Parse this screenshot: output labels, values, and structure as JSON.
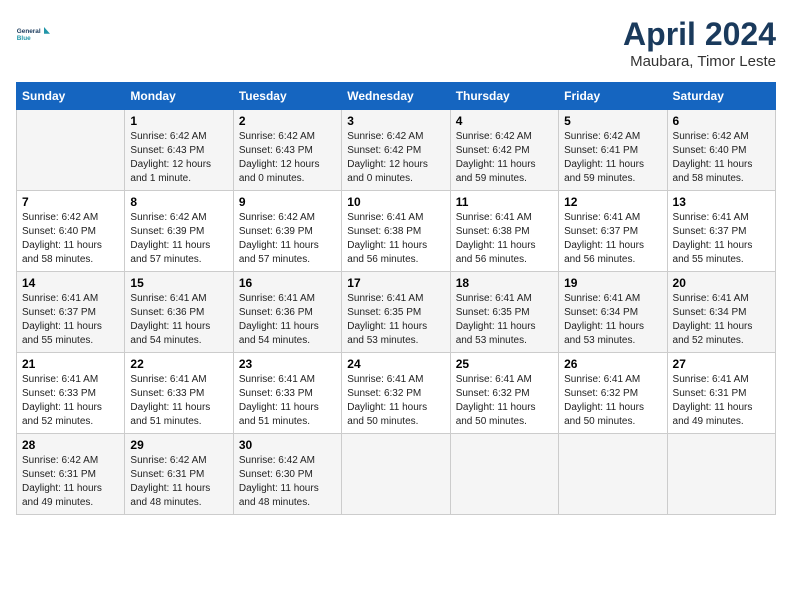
{
  "header": {
    "logo_line1": "General",
    "logo_line2": "Blue",
    "month": "April 2024",
    "location": "Maubara, Timor Leste"
  },
  "days_of_week": [
    "Sunday",
    "Monday",
    "Tuesday",
    "Wednesday",
    "Thursday",
    "Friday",
    "Saturday"
  ],
  "weeks": [
    [
      {
        "day": "",
        "info": ""
      },
      {
        "day": "1",
        "info": "Sunrise: 6:42 AM\nSunset: 6:43 PM\nDaylight: 12 hours\nand 1 minute."
      },
      {
        "day": "2",
        "info": "Sunrise: 6:42 AM\nSunset: 6:43 PM\nDaylight: 12 hours\nand 0 minutes."
      },
      {
        "day": "3",
        "info": "Sunrise: 6:42 AM\nSunset: 6:42 PM\nDaylight: 12 hours\nand 0 minutes."
      },
      {
        "day": "4",
        "info": "Sunrise: 6:42 AM\nSunset: 6:42 PM\nDaylight: 11 hours\nand 59 minutes."
      },
      {
        "day": "5",
        "info": "Sunrise: 6:42 AM\nSunset: 6:41 PM\nDaylight: 11 hours\nand 59 minutes."
      },
      {
        "day": "6",
        "info": "Sunrise: 6:42 AM\nSunset: 6:40 PM\nDaylight: 11 hours\nand 58 minutes."
      }
    ],
    [
      {
        "day": "7",
        "info": "Sunrise: 6:42 AM\nSunset: 6:40 PM\nDaylight: 11 hours\nand 58 minutes."
      },
      {
        "day": "8",
        "info": "Sunrise: 6:42 AM\nSunset: 6:39 PM\nDaylight: 11 hours\nand 57 minutes."
      },
      {
        "day": "9",
        "info": "Sunrise: 6:42 AM\nSunset: 6:39 PM\nDaylight: 11 hours\nand 57 minutes."
      },
      {
        "day": "10",
        "info": "Sunrise: 6:41 AM\nSunset: 6:38 PM\nDaylight: 11 hours\nand 56 minutes."
      },
      {
        "day": "11",
        "info": "Sunrise: 6:41 AM\nSunset: 6:38 PM\nDaylight: 11 hours\nand 56 minutes."
      },
      {
        "day": "12",
        "info": "Sunrise: 6:41 AM\nSunset: 6:37 PM\nDaylight: 11 hours\nand 56 minutes."
      },
      {
        "day": "13",
        "info": "Sunrise: 6:41 AM\nSunset: 6:37 PM\nDaylight: 11 hours\nand 55 minutes."
      }
    ],
    [
      {
        "day": "14",
        "info": "Sunrise: 6:41 AM\nSunset: 6:37 PM\nDaylight: 11 hours\nand 55 minutes."
      },
      {
        "day": "15",
        "info": "Sunrise: 6:41 AM\nSunset: 6:36 PM\nDaylight: 11 hours\nand 54 minutes."
      },
      {
        "day": "16",
        "info": "Sunrise: 6:41 AM\nSunset: 6:36 PM\nDaylight: 11 hours\nand 54 minutes."
      },
      {
        "day": "17",
        "info": "Sunrise: 6:41 AM\nSunset: 6:35 PM\nDaylight: 11 hours\nand 53 minutes."
      },
      {
        "day": "18",
        "info": "Sunrise: 6:41 AM\nSunset: 6:35 PM\nDaylight: 11 hours\nand 53 minutes."
      },
      {
        "day": "19",
        "info": "Sunrise: 6:41 AM\nSunset: 6:34 PM\nDaylight: 11 hours\nand 53 minutes."
      },
      {
        "day": "20",
        "info": "Sunrise: 6:41 AM\nSunset: 6:34 PM\nDaylight: 11 hours\nand 52 minutes."
      }
    ],
    [
      {
        "day": "21",
        "info": "Sunrise: 6:41 AM\nSunset: 6:33 PM\nDaylight: 11 hours\nand 52 minutes."
      },
      {
        "day": "22",
        "info": "Sunrise: 6:41 AM\nSunset: 6:33 PM\nDaylight: 11 hours\nand 51 minutes."
      },
      {
        "day": "23",
        "info": "Sunrise: 6:41 AM\nSunset: 6:33 PM\nDaylight: 11 hours\nand 51 minutes."
      },
      {
        "day": "24",
        "info": "Sunrise: 6:41 AM\nSunset: 6:32 PM\nDaylight: 11 hours\nand 50 minutes."
      },
      {
        "day": "25",
        "info": "Sunrise: 6:41 AM\nSunset: 6:32 PM\nDaylight: 11 hours\nand 50 minutes."
      },
      {
        "day": "26",
        "info": "Sunrise: 6:41 AM\nSunset: 6:32 PM\nDaylight: 11 hours\nand 50 minutes."
      },
      {
        "day": "27",
        "info": "Sunrise: 6:41 AM\nSunset: 6:31 PM\nDaylight: 11 hours\nand 49 minutes."
      }
    ],
    [
      {
        "day": "28",
        "info": "Sunrise: 6:42 AM\nSunset: 6:31 PM\nDaylight: 11 hours\nand 49 minutes."
      },
      {
        "day": "29",
        "info": "Sunrise: 6:42 AM\nSunset: 6:31 PM\nDaylight: 11 hours\nand 48 minutes."
      },
      {
        "day": "30",
        "info": "Sunrise: 6:42 AM\nSunset: 6:30 PM\nDaylight: 11 hours\nand 48 minutes."
      },
      {
        "day": "",
        "info": ""
      },
      {
        "day": "",
        "info": ""
      },
      {
        "day": "",
        "info": ""
      },
      {
        "day": "",
        "info": ""
      }
    ]
  ]
}
